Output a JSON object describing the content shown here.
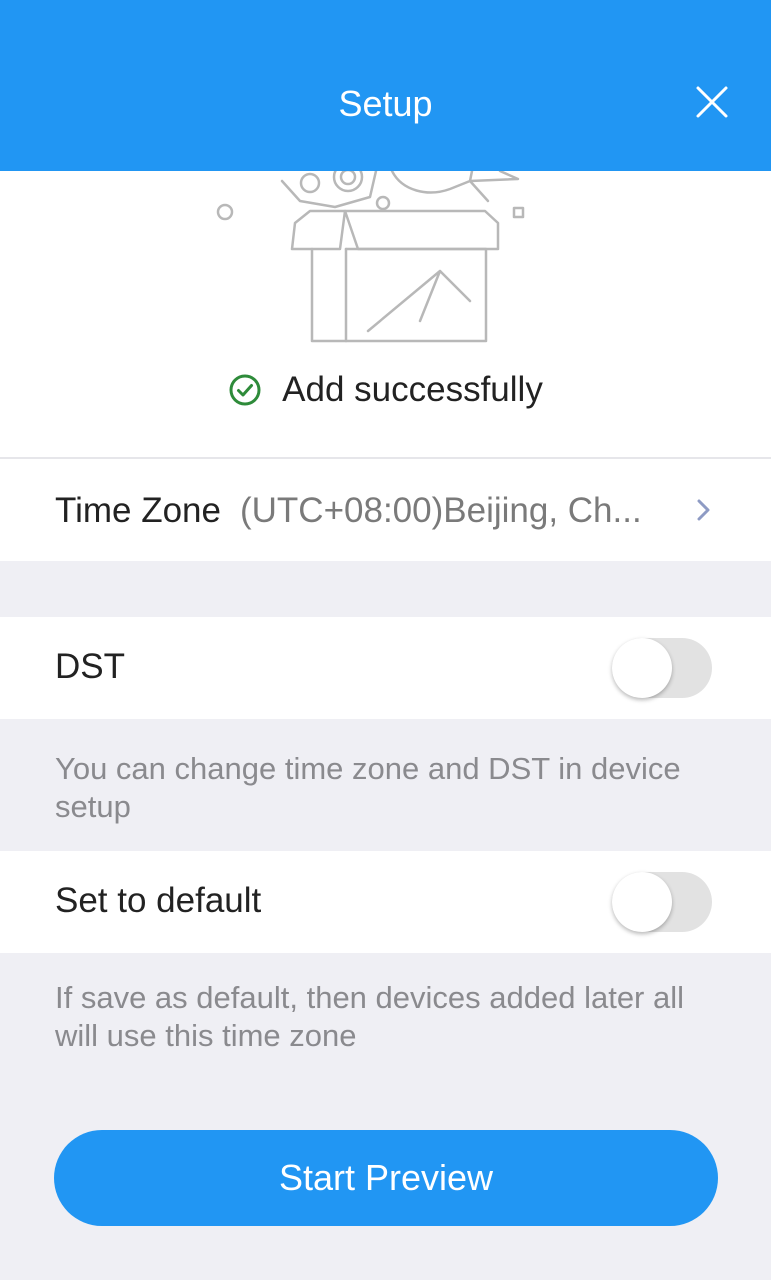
{
  "header": {
    "title": "Setup",
    "close_icon": "close-icon"
  },
  "status": {
    "icon": "check-circle-icon",
    "text": "Add successfully"
  },
  "time_zone": {
    "label": "Time Zone",
    "value": "(UTC+08:00)Beijing, Ch...",
    "icon": "chevron-right-icon"
  },
  "dst": {
    "label": "DST",
    "enabled": false
  },
  "dst_note": "You can change time zone and DST in device setup",
  "set_default": {
    "label": "Set to default",
    "enabled": false
  },
  "default_note": "If save as default, then devices added later all will use this time zone",
  "start_button": "Start Preview",
  "colors": {
    "accent": "#2196f3",
    "background": "#efeff4",
    "success": "#2e8b3a"
  }
}
